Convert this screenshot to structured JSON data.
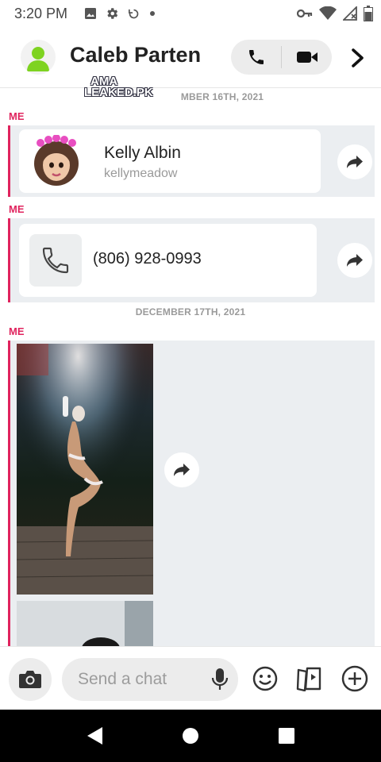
{
  "status_bar": {
    "time": "3:20 PM"
  },
  "header": {
    "contact_name": "Caleb Parten"
  },
  "watermark": {
    "line1": "AMA",
    "line2": "LEAKED.PK"
  },
  "conversation": {
    "date_1": "MBER 16TH, 2021",
    "date_2": "DECEMBER 17TH, 2021",
    "messages": [
      {
        "sender": "ME",
        "type": "contact",
        "name": "Kelly Albin",
        "username": "kellymeadow"
      },
      {
        "sender": "ME",
        "type": "phone",
        "number": "(806) 928-0993"
      },
      {
        "sender": "ME",
        "type": "media"
      }
    ]
  },
  "composer": {
    "placeholder": "Send a chat"
  },
  "colors": {
    "accent": "#e0245e",
    "bubble_bg": "#ebeef1",
    "text": "#222222",
    "muted": "#9a9a9a"
  },
  "icons": [
    "gallery-icon",
    "settings-icon",
    "sync-icon",
    "dot-icon",
    "vpn-key-icon",
    "wifi-icon",
    "signal-icon",
    "battery-icon",
    "phone-icon",
    "video-icon",
    "chevron-right-icon",
    "share-arrow-icon",
    "camera-icon",
    "microphone-icon",
    "emoji-icon",
    "stickers-icon",
    "plus-circle-icon",
    "back-nav-icon",
    "home-nav-icon",
    "recents-nav-icon"
  ]
}
